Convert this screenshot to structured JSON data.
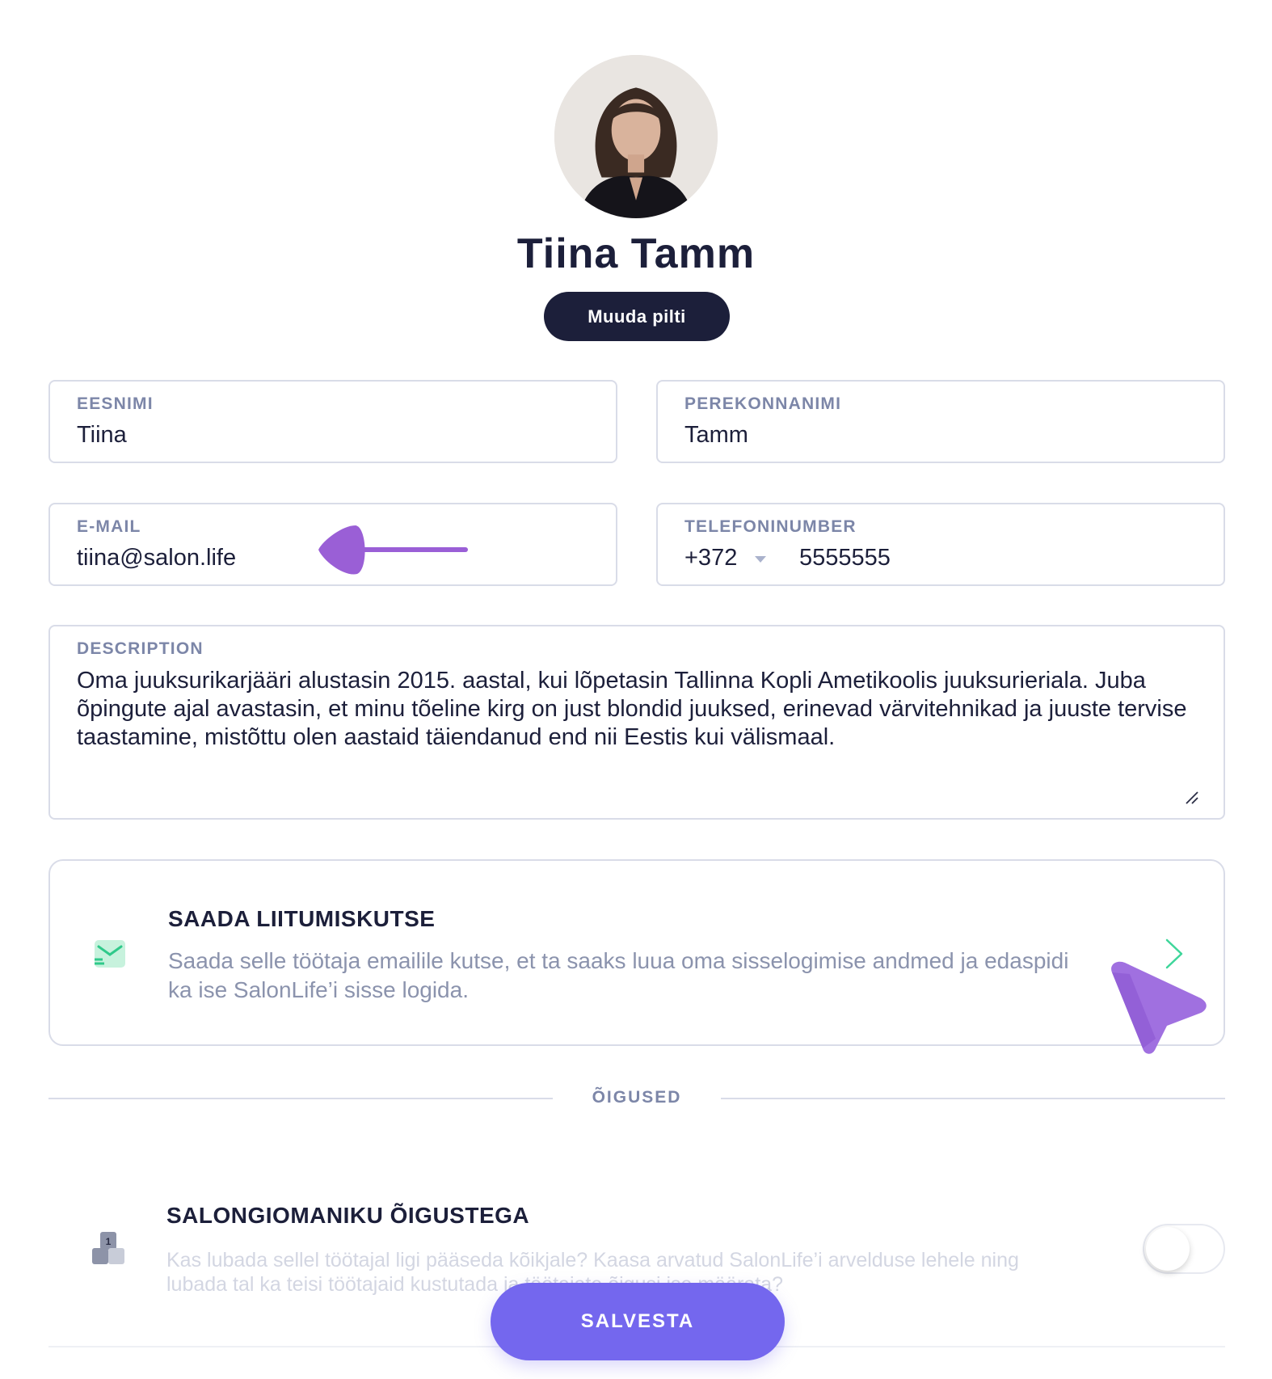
{
  "profile": {
    "name": "Tiina Tamm",
    "change_photo_label": "Muuda pilti"
  },
  "fields": {
    "first_name": {
      "label": "EESNIMI",
      "value": "Tiina"
    },
    "last_name": {
      "label": "PEREKONNANIMI",
      "value": "Tamm"
    },
    "email": {
      "label": "E-MAIL",
      "value": "tiina@salon.life"
    },
    "phone": {
      "label": "TELEFONINUMBER",
      "country_code": "+372",
      "number": "5555555"
    },
    "description": {
      "label": "DESCRIPTION",
      "value": "Oma juuksurikarjääri alustasin 2015. aastal, kui lõpetasin Tallinna Kopli Ametikoolis juuksurieriala. Juba õpingute ajal avastasin, et minu tõeline kirg on just blondid juuksed, erinevad värvitehnikad ja juuste tervise taastamine, mistõttu olen aastaid täiendanud end nii Eestis kui välismaal."
    }
  },
  "invite": {
    "title": "SAADA LIITUMISKUTSE",
    "description": "Saada selle töötaja emailile kutse, et ta saaks luua oma sisselogimise andmed ja edaspidi ka ise SalonLife’i sisse logida.",
    "icon": "envelope-icon"
  },
  "rights": {
    "section_label": "ÕIGUSED",
    "owner": {
      "title": "SALONGIOMANIKU ÕIGUSTEGA",
      "description": "Kas lubada sellel töötajal ligi pääseda kõikjale? Kaasa arvatud SalonLife’i arvelduse lehele ning lubada tal ka teisi töötajaid kustutada ja töötajate õigusi ise määrata?",
      "enabled": false
    }
  },
  "actions": {
    "save_label": "SALVESTA"
  },
  "colors": {
    "primary_dark": "#1c1f3a",
    "accent_purple": "#7467ee",
    "annotation_purple": "#9a5fd6",
    "invite_green": "#3ed69a",
    "label_gray": "#7c86a8"
  }
}
